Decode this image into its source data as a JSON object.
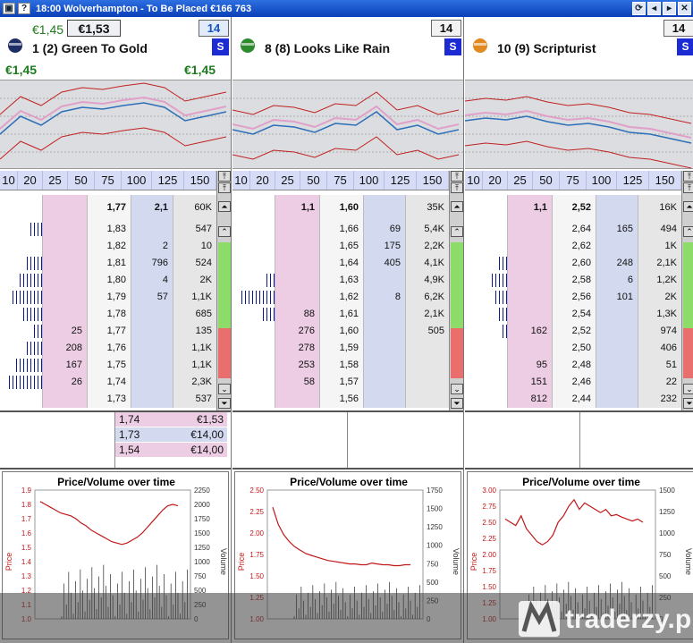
{
  "window": {
    "title": "18:00  Wolverhampton - To Be Placed   €166 763"
  },
  "colors": {
    "back": "#d3daf0",
    "lay": "#eccde3",
    "green": "#1e7b1e",
    "price_line": "#c01818"
  },
  "ladder_header": [
    "10",
    "20",
    "25",
    "50",
    "75",
    "100",
    "125",
    "150"
  ],
  "runners": [
    {
      "label": "1  (2) Green To Gold",
      "silk_icon": "jockey-silk-navy-icon",
      "back_price": "€1,45",
      "selected_price": "€1,53",
      "box_number": "14",
      "s_label": "S",
      "green_left": "€1,45",
      "green_right": "€1,45",
      "total": {
        "lay": "",
        "price": "1,77",
        "back": "2,1",
        "traded": "60K"
      },
      "rows": [
        {
          "vol": 4,
          "lay": "",
          "price": "1,83",
          "back": "",
          "traded": "547"
        },
        {
          "vol": 0,
          "lay": "",
          "price": "1,82",
          "back": "2",
          "traded": "10"
        },
        {
          "vol": 5,
          "lay": "",
          "price": "1,81",
          "back": "796",
          "traded": "524"
        },
        {
          "vol": 7,
          "lay": "",
          "price": "1,80",
          "back": "4",
          "traded": "2K"
        },
        {
          "vol": 9,
          "lay": "",
          "price": "1,79",
          "back": "57",
          "traded": "1,1K"
        },
        {
          "vol": 6,
          "lay": "",
          "price": "1,78",
          "back": "",
          "traded": "685"
        },
        {
          "vol": 3,
          "lay": "25",
          "price": "1,77",
          "back": "",
          "traded": "135"
        },
        {
          "vol": 5,
          "lay": "208",
          "price": "1,76",
          "back": "",
          "traded": "1,1K"
        },
        {
          "vol": 8,
          "lay": "167",
          "price": "1,75",
          "back": "",
          "traded": "1,1K"
        },
        {
          "vol": 10,
          "lay": "26",
          "price": "1,74",
          "back": "",
          "traded": "2,3K"
        },
        {
          "vol": 0,
          "lay": "",
          "price": "1,73",
          "back": "",
          "traded": "537"
        }
      ],
      "orders": [
        {
          "price": "1,74",
          "stake": "€1,53",
          "side": "lay"
        },
        {
          "price": "1,73",
          "stake": "€14,00",
          "side": "back"
        },
        {
          "price": "1,54",
          "stake": "€14,00",
          "side": "lay"
        }
      ],
      "chart": {
        "title": "Price/Volume over time",
        "price_label": "Price",
        "volume_label": "Volume",
        "price_ticks": [
          "1.0",
          "1.1",
          "1.2",
          "1.3",
          "1.4",
          "1.5",
          "1.6",
          "1.7",
          "1.8",
          "1.9"
        ],
        "volume_ticks": [
          "0",
          "250",
          "500",
          "750",
          "1000",
          "1250",
          "1500",
          "1750",
          "2000",
          "2250"
        ],
        "price_series": [
          1.82,
          1.8,
          1.78,
          1.76,
          1.74,
          1.73,
          1.72,
          1.7,
          1.67,
          1.65,
          1.62,
          1.6,
          1.58,
          1.56,
          1.54,
          1.53,
          1.52,
          1.53,
          1.55,
          1.57,
          1.6,
          1.64,
          1.68,
          1.72,
          1.76,
          1.79,
          1.8,
          1.79
        ]
      }
    },
    {
      "label": "8  (8) Looks Like Rain",
      "silk_icon": "jockey-silk-green-icon",
      "back_price": "",
      "selected_price": "",
      "box_number": "14",
      "s_label": "S",
      "green_left": "",
      "green_right": "",
      "total": {
        "lay": "1,1",
        "price": "1,60",
        "back": "",
        "traded": "35K"
      },
      "rows": [
        {
          "vol": 0,
          "lay": "",
          "price": "1,66",
          "back": "69",
          "traded": "5,4K"
        },
        {
          "vol": 0,
          "lay": "",
          "price": "1,65",
          "back": "175",
          "traded": "2,2K"
        },
        {
          "vol": 0,
          "lay": "",
          "price": "1,64",
          "back": "405",
          "traded": "4,1K"
        },
        {
          "vol": 3,
          "lay": "",
          "price": "1,63",
          "back": "",
          "traded": "4,9K"
        },
        {
          "vol": 10,
          "lay": "",
          "price": "1,62",
          "back": "8",
          "traded": "6,2K"
        },
        {
          "vol": 4,
          "lay": "88",
          "price": "1,61",
          "back": "",
          "traded": "2,1K"
        },
        {
          "vol": 0,
          "lay": "276",
          "price": "1,60",
          "back": "",
          "traded": "505"
        },
        {
          "vol": 0,
          "lay": "278",
          "price": "1,59",
          "back": "",
          "traded": ""
        },
        {
          "vol": 0,
          "lay": "253",
          "price": "1,58",
          "back": "",
          "traded": ""
        },
        {
          "vol": 0,
          "lay": "58",
          "price": "1,57",
          "back": "",
          "traded": ""
        },
        {
          "vol": 0,
          "lay": "",
          "price": "1,56",
          "back": "",
          "traded": ""
        }
      ],
      "orders": [],
      "chart": {
        "title": "Price/Volume over time",
        "price_label": "Price",
        "volume_label": "Volume",
        "price_ticks": [
          "1.00",
          "1.25",
          "1.50",
          "1.75",
          "2.00",
          "2.25",
          "2.50"
        ],
        "volume_ticks": [
          "0",
          "250",
          "500",
          "750",
          "1000",
          "1250",
          "1500",
          "1750"
        ],
        "price_series": [
          2.3,
          2.1,
          1.98,
          1.9,
          1.84,
          1.8,
          1.76,
          1.74,
          1.72,
          1.7,
          1.68,
          1.67,
          1.66,
          1.65,
          1.64,
          1.64,
          1.63,
          1.63,
          1.65,
          1.64,
          1.63,
          1.63,
          1.62,
          1.62,
          1.63,
          1.63
        ]
      }
    },
    {
      "label": "10  (9) Scripturist",
      "silk_icon": "jockey-silk-orange-icon",
      "back_price": "",
      "selected_price": "",
      "box_number": "14",
      "s_label": "S",
      "green_left": "",
      "green_right": "",
      "total": {
        "lay": "1,1",
        "price": "2,52",
        "back": "",
        "traded": "16K"
      },
      "rows": [
        {
          "vol": 0,
          "lay": "",
          "price": "2,64",
          "back": "165",
          "traded": "494"
        },
        {
          "vol": 0,
          "lay": "",
          "price": "2,62",
          "back": "",
          "traded": "1K"
        },
        {
          "vol": 3,
          "lay": "",
          "price": "2,60",
          "back": "248",
          "traded": "2,1K"
        },
        {
          "vol": 5,
          "lay": "",
          "price": "2,58",
          "back": "6",
          "traded": "1,2K"
        },
        {
          "vol": 4,
          "lay": "",
          "price": "2,56",
          "back": "101",
          "traded": "2K"
        },
        {
          "vol": 3,
          "lay": "",
          "price": "2,54",
          "back": "",
          "traded": "1,3K"
        },
        {
          "vol": 2,
          "lay": "162",
          "price": "2,52",
          "back": "",
          "traded": "974"
        },
        {
          "vol": 0,
          "lay": "",
          "price": "2,50",
          "back": "",
          "traded": "406"
        },
        {
          "vol": 0,
          "lay": "95",
          "price": "2,48",
          "back": "",
          "traded": "51"
        },
        {
          "vol": 0,
          "lay": "151",
          "price": "2,46",
          "back": "",
          "traded": "22"
        },
        {
          "vol": 0,
          "lay": "812",
          "price": "2,44",
          "back": "",
          "traded": "232"
        }
      ],
      "orders": [],
      "chart": {
        "title": "Price/Volume over time",
        "price_label": "Price",
        "volume_label": "Volume",
        "price_ticks": [
          "1.00",
          "1.25",
          "1.50",
          "1.75",
          "2.00",
          "2.25",
          "2.50",
          "2.75",
          "3.00"
        ],
        "volume_ticks": [
          "0",
          "250",
          "500",
          "750",
          "1000",
          "1250",
          "1500"
        ],
        "price_series": [
          2.55,
          2.5,
          2.45,
          2.6,
          2.4,
          2.3,
          2.2,
          2.15,
          2.2,
          2.3,
          2.5,
          2.6,
          2.75,
          2.85,
          2.7,
          2.8,
          2.75,
          2.7,
          2.65,
          2.7,
          2.6,
          2.62,
          2.58,
          2.55,
          2.52,
          2.55,
          2.5
        ]
      }
    }
  ],
  "watermark": {
    "text": "traderzy.pl"
  }
}
